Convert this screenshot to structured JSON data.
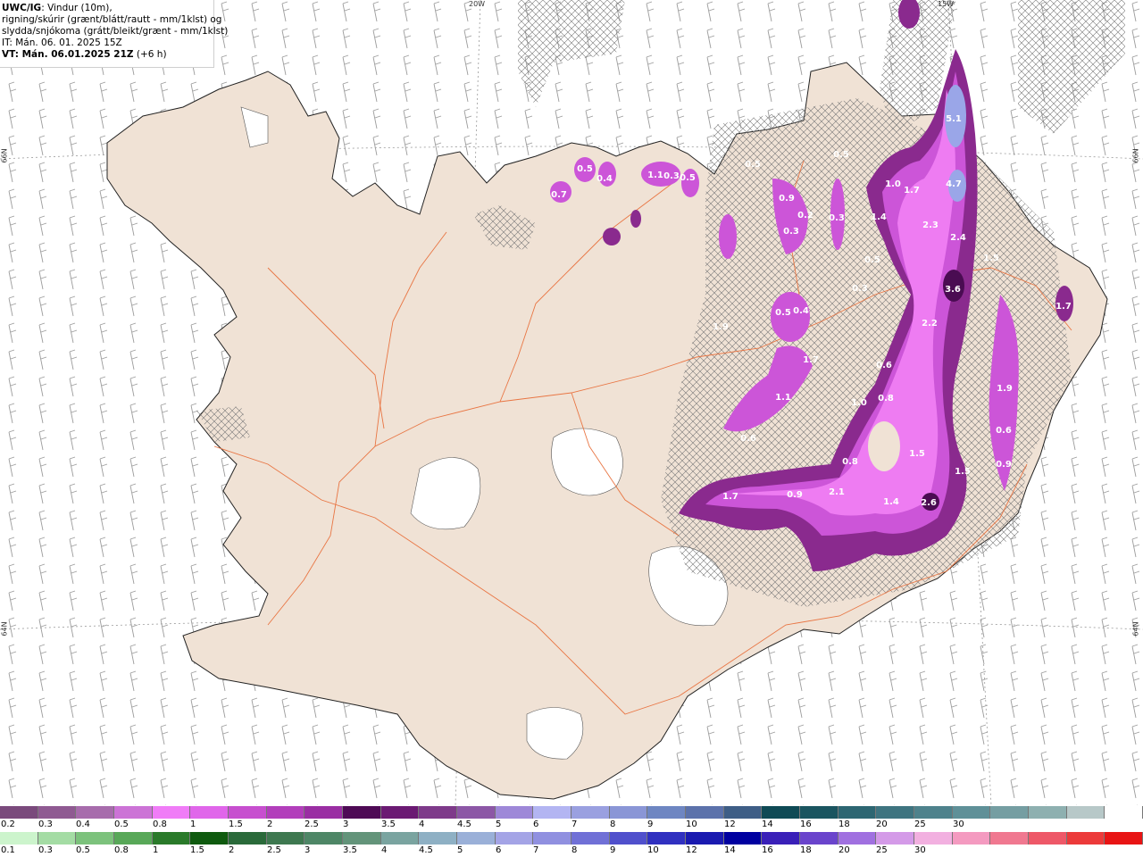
{
  "info": {
    "model": "UWC/IG",
    "line1_rest": ": Vindur (10m),",
    "line2": "rigning/skúrir (grænt/blátt/rautt - mm/1klst) og",
    "line3": "slydda/snjókoma (grátt/bleikt/grænt - mm/1klst)",
    "it": "IT: Mán. 06. 01. 2025 15Z",
    "vt": "VT: Mán. 06.01.2025 21Z",
    "vt_offset": "(+6 h)"
  },
  "axes": {
    "lon_20": "20W",
    "lon_15": "15W",
    "lat_66_left": "66N",
    "lat_66_right": "66N",
    "lat_64_left": "64N",
    "lat_64_right": "64N"
  },
  "colors": {
    "land": "#f0e2d5",
    "ice": "#ffffff",
    "roads": "#e8703c",
    "coast": "#222222",
    "precip_light": "#ee7cf2",
    "precip_mid": "#cc55d8",
    "precip_dark": "#8a2a8e",
    "precip_deep": "#4a0c52",
    "precip_blue": "#9aa6e8"
  },
  "precip_labels": [
    {
      "text": "5.1"
    },
    {
      "text": "4.7"
    },
    {
      "text": "1.7"
    },
    {
      "text": "1.0"
    },
    {
      "text": "1.4"
    },
    {
      "text": "2.3"
    },
    {
      "text": "2.4"
    },
    {
      "text": "1.5"
    },
    {
      "text": "0.5"
    },
    {
      "text": "0.3"
    },
    {
      "text": "3.6"
    },
    {
      "text": "2.2"
    },
    {
      "text": "0.6"
    },
    {
      "text": "0.8"
    },
    {
      "text": "1.0"
    },
    {
      "text": "0.8"
    },
    {
      "text": "1.5"
    },
    {
      "text": "1.5"
    },
    {
      "text": "1.9"
    },
    {
      "text": "2.6"
    },
    {
      "text": "1.4"
    },
    {
      "text": "2.1"
    },
    {
      "text": "0.9"
    },
    {
      "text": "1.7"
    },
    {
      "text": "0.6"
    },
    {
      "text": "0.6"
    },
    {
      "text": "0.5"
    },
    {
      "text": "0.4"
    },
    {
      "text": "1.7"
    },
    {
      "text": "1.1"
    },
    {
      "text": "0.9"
    },
    {
      "text": "0.2"
    },
    {
      "text": "0.3"
    },
    {
      "text": "0.3"
    },
    {
      "text": "0.5"
    },
    {
      "text": "0.5"
    },
    {
      "text": "1.1"
    },
    {
      "text": "0.3"
    },
    {
      "text": "0.5"
    },
    {
      "text": "0.5"
    },
    {
      "text": "0.4"
    },
    {
      "text": "0.7"
    },
    {
      "text": "1.9"
    },
    {
      "text": "1.7"
    },
    {
      "text": "0.9"
    }
  ],
  "legend_top": {
    "colors": [
      "#7a4a7c",
      "#8f5a92",
      "#a76cac",
      "#cc73d6",
      "#f07cf7",
      "#e066ea",
      "#c74fcf",
      "#b23ebb",
      "#9a2ea3",
      "#4e0a55",
      "#6b1a73",
      "#7e3a8a",
      "#8c57a6",
      "#9e88d8",
      "#b3b5f2",
      "#9aa0e0",
      "#8a96d6",
      "#6e86c2",
      "#5c72ab",
      "#3e5e86",
      "#0f4a55",
      "#1a5560",
      "#2d6672",
      "#3e7480",
      "#4e828c",
      "#5f9098",
      "#759ea2",
      "#8eb0b0",
      "#b7c8c8",
      "#ffffff"
    ],
    "labels": [
      "0.2",
      "0.3",
      "0.4",
      "0.5",
      "0.8",
      "1",
      "1.5",
      "2",
      "2.5",
      "3",
      "3.5",
      "4",
      "4.5",
      "5",
      "6",
      "7",
      "8",
      "9",
      "10",
      "12",
      "14",
      "16",
      "18",
      "20",
      "25",
      "30"
    ]
  },
  "legend_bottom": {
    "colors": [
      "#ccf4cc",
      "#a4dca4",
      "#7cc27c",
      "#58a858",
      "#2a7a2a",
      "#0f5a0f",
      "#2a6a3a",
      "#3e7850",
      "#4e8666",
      "#63947a",
      "#7aa4a0",
      "#8eb0c4",
      "#9ab0d8",
      "#a4a4e6",
      "#9090e0",
      "#7070d6",
      "#5050cc",
      "#3030c0",
      "#1a1ab0",
      "#0000a0",
      "#3a20b8",
      "#6a44cc",
      "#a070e0",
      "#d49ae8",
      "#f2b0e0",
      "#f49ac0",
      "#f07890",
      "#ee5868",
      "#ec3a3a",
      "#e81414"
    ],
    "labels": [
      "0.1",
      "0.3",
      "0.5",
      "0.8",
      "1",
      "1.5",
      "2",
      "2.5",
      "3",
      "3.5",
      "4",
      "4.5",
      "5",
      "6",
      "7",
      "8",
      "9",
      "10",
      "12",
      "14",
      "16",
      "18",
      "20",
      "25",
      "30"
    ]
  }
}
